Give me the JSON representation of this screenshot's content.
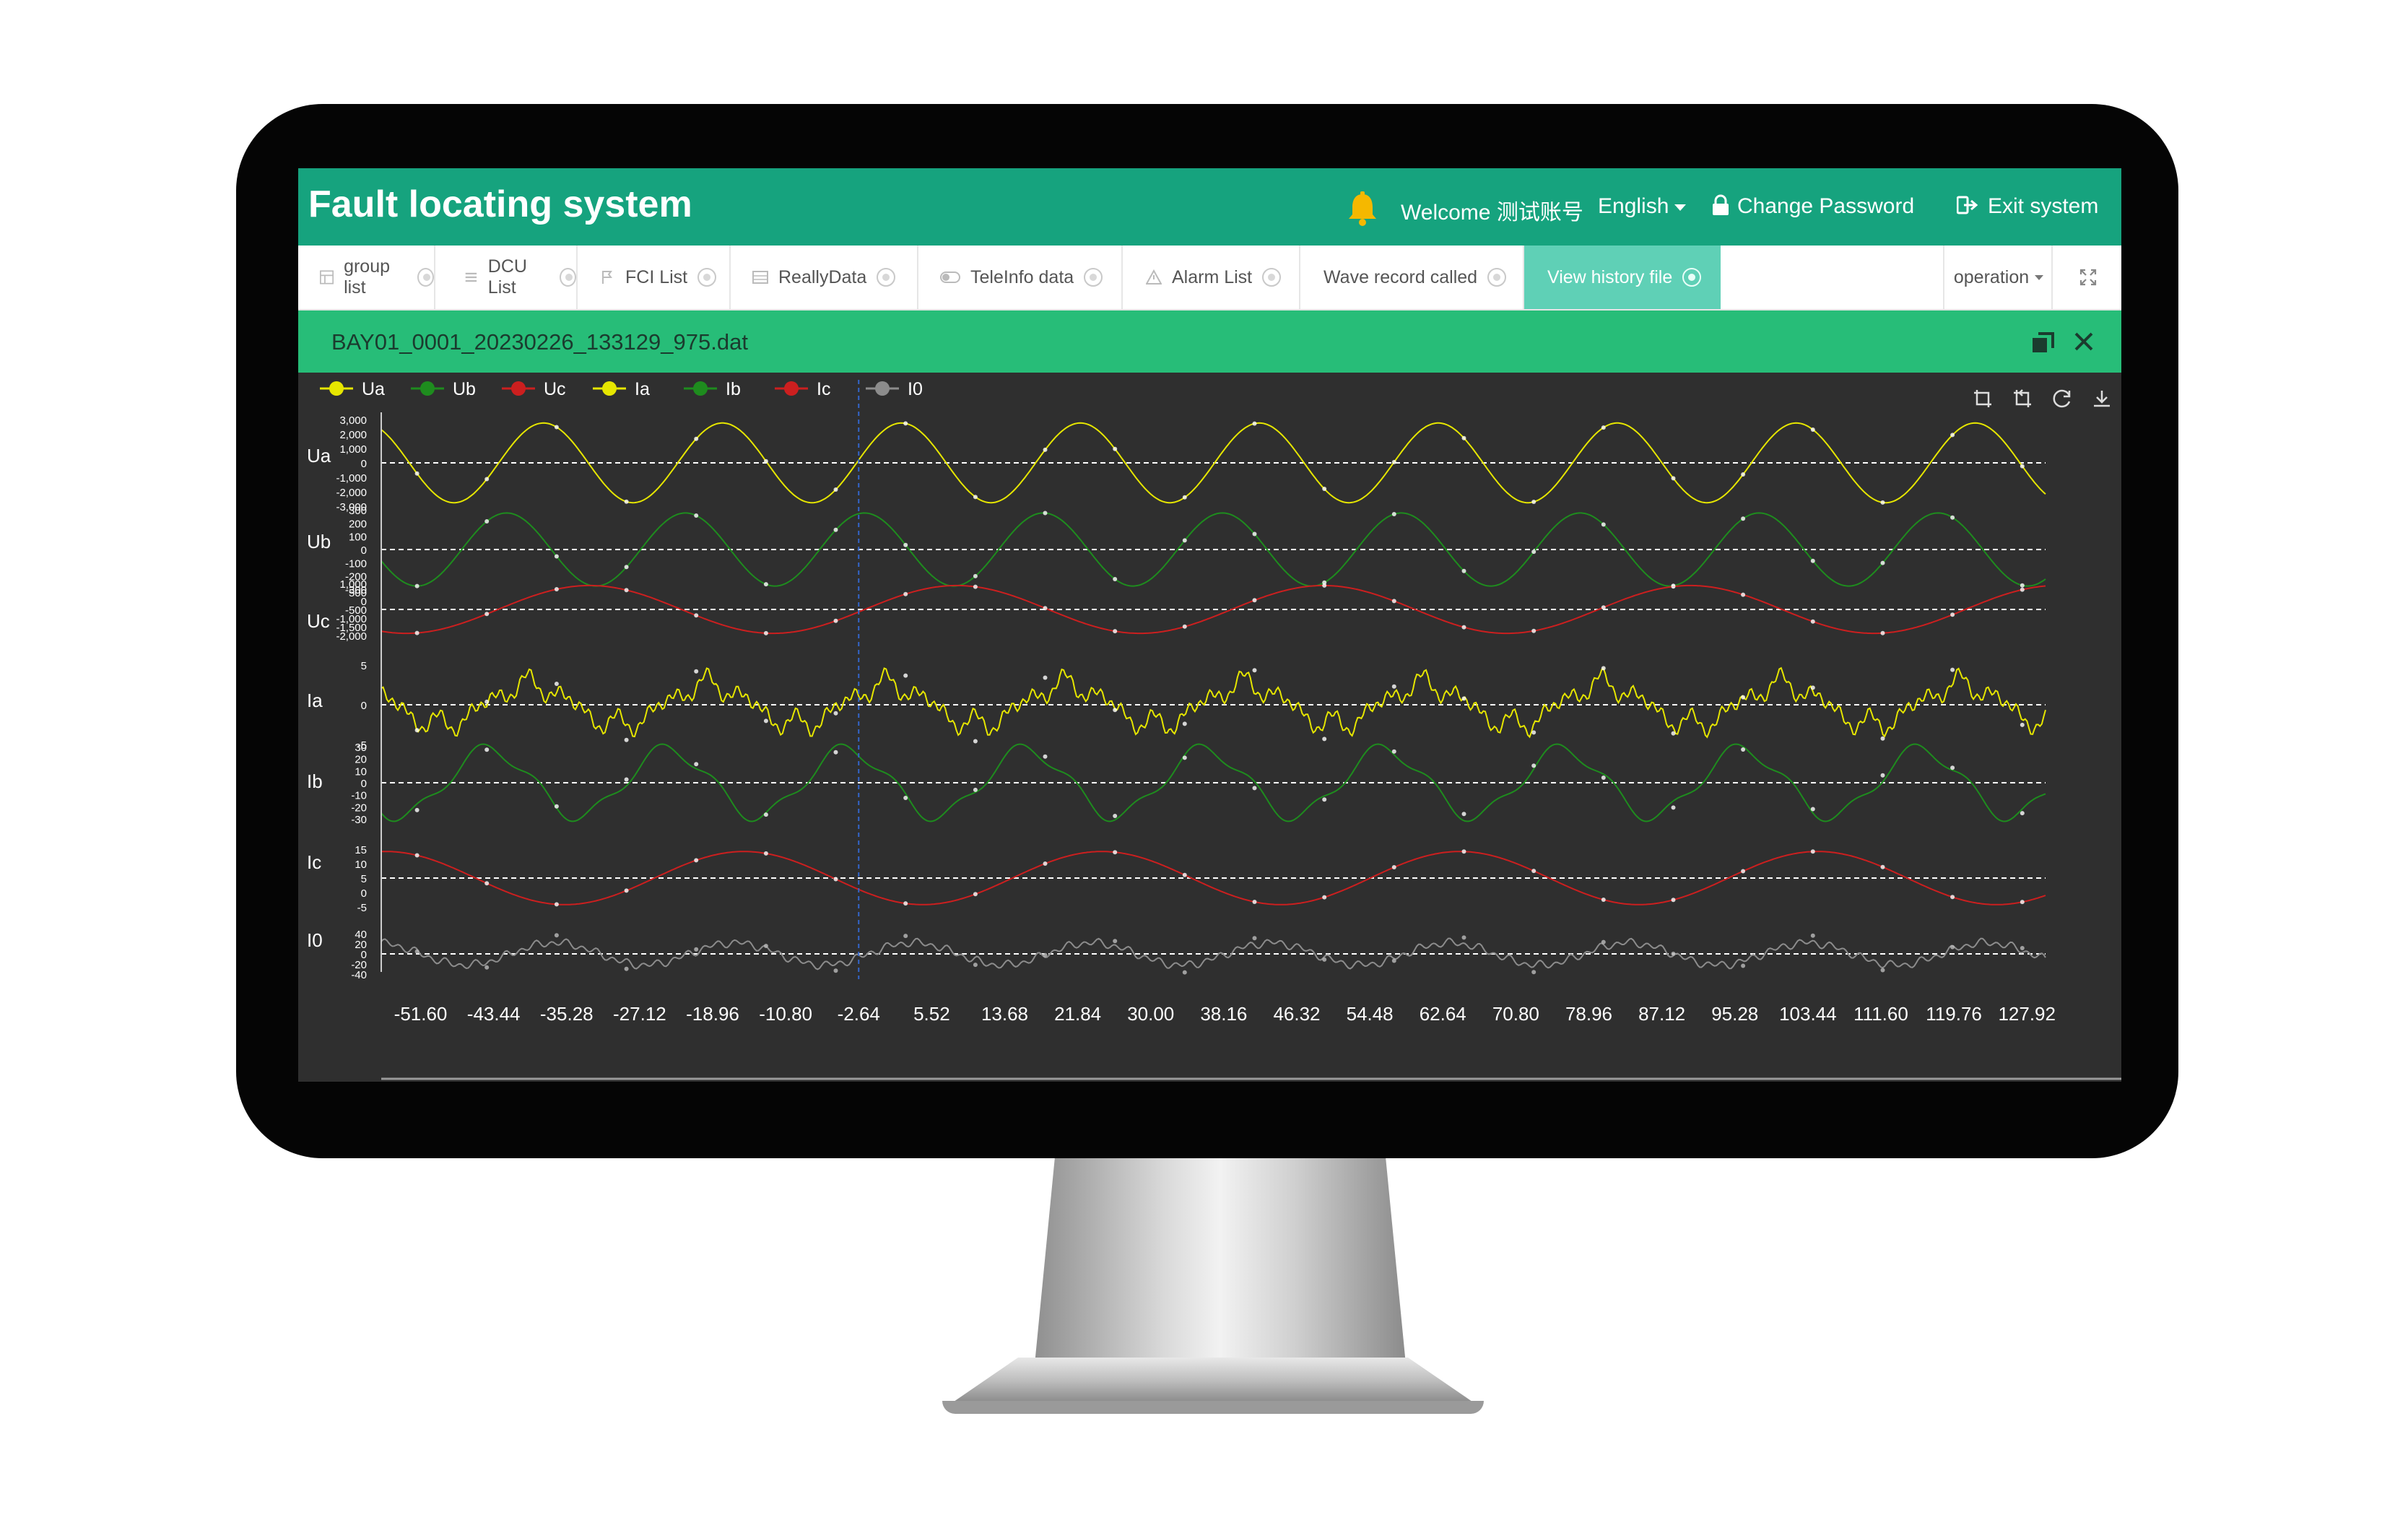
{
  "header": {
    "title": "Fault locating system",
    "welcome": "Welcome 测试账号",
    "language": "English",
    "change_password": "Change Password",
    "exit": "Exit system",
    "accent": "#16a37e"
  },
  "tabs": [
    {
      "label": "group list",
      "icon": "grid-icon"
    },
    {
      "label": "DCU List",
      "icon": "list-icon"
    },
    {
      "label": "FCI List",
      "icon": "flag-icon"
    },
    {
      "label": "ReallyData",
      "icon": "table-icon"
    },
    {
      "label": "TeleInfo data",
      "icon": "toggle-icon"
    },
    {
      "label": "Alarm List",
      "icon": "warning-icon"
    },
    {
      "label": "Wave record called",
      "icon": ""
    },
    {
      "label": "View history file",
      "icon": "",
      "active": true
    }
  ],
  "operation": "operation",
  "file": {
    "name": "BAY01_0001_20230226_133129_975.dat"
  },
  "toolbox": [
    "zoom-select-icon",
    "zoom-reset-icon",
    "restore-icon",
    "download-icon"
  ],
  "chart_data": {
    "type": "line",
    "legend": [
      "Ua",
      "Ub",
      "Uc",
      "Ia",
      "Ib",
      "Ic",
      "I0"
    ],
    "legend_placement": "top-left",
    "x_ticks": [
      "-51.60",
      "-43.44",
      "-35.28",
      "-27.12",
      "-18.96",
      "-10.80",
      "-2.64",
      "5.52",
      "13.68",
      "21.84",
      "30.00",
      "38.16",
      "46.32",
      "54.48",
      "62.64",
      "70.80",
      "78.96",
      "87.12",
      "95.28",
      "103.44",
      "111.60",
      "119.76",
      "127.92"
    ],
    "cursor_x": -2.64,
    "series": [
      {
        "name": "Ua",
        "color": "#e6e600",
        "ticks": [
          "3,000",
          "2,000",
          "1,000",
          "0",
          "-1,000",
          "-2,000",
          "-3,000"
        ],
        "amplitude": 2500,
        "period": 20.0,
        "phase": 0.9
      },
      {
        "name": "Ub",
        "color": "#1e8c1e",
        "ticks": [
          "300",
          "200",
          "100",
          "0",
          "-100",
          "-200",
          "-300"
        ],
        "amplitude": 250,
        "period": 20.0,
        "phase": 2.2
      },
      {
        "name": "Uc",
        "color": "#cc1f1f",
        "ticks": [
          "1,000",
          "500",
          "0",
          "-500",
          "-1,000",
          "-1,500",
          "-2,000"
        ],
        "amplitude": 1000,
        "period": 41.0,
        "phase": 0.3
      },
      {
        "name": "Ia",
        "color": "#e6e600",
        "ticks": [
          "5",
          "0",
          "-5"
        ],
        "amplitude": 4,
        "period": 20.0,
        "phase": 1.4
      },
      {
        "name": "Ib",
        "color": "#1e8c1e",
        "ticks": [
          "30",
          "20",
          "10",
          "0",
          "-10",
          "-20",
          "-30"
        ],
        "amplitude": 25,
        "period": 20.0,
        "phase": 2.8
      },
      {
        "name": "Ic",
        "color": "#cc1f1f",
        "ticks": [
          "15",
          "10",
          "5",
          "0",
          "-5"
        ],
        "amplitude": 8,
        "period": 40.0,
        "phase": 4.0
      },
      {
        "name": "I0",
        "color": "#8c8c8c",
        "ticks": [
          "40",
          "20",
          "0",
          "-20",
          "-40"
        ],
        "amplitude": 25,
        "period": 20.0,
        "phase": 0.5
      }
    ]
  }
}
